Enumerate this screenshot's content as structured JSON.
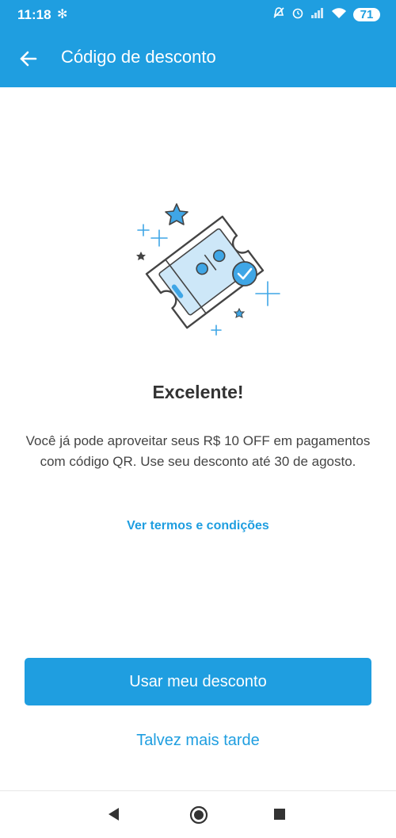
{
  "status_bar": {
    "time": "11:18",
    "bluetooth_icon": "✻",
    "battery": "71"
  },
  "header": {
    "title": "Código de desconto",
    "back_icon": "arrow-left-icon"
  },
  "content": {
    "illustration": "coupon-ticket-illustration",
    "headline": "Excelente!",
    "description": "Você já pode aproveitar seus R$ 10 OFF em pagamentos com código QR. Use seu desconto até 30 de agosto.",
    "terms_link": "Ver termos e condições"
  },
  "actions": {
    "primary": "Usar meu desconto",
    "secondary": "Talvez mais tarde"
  },
  "colors": {
    "accent": "#1f9ee0",
    "text": "#333333",
    "background": "#ffffff"
  }
}
